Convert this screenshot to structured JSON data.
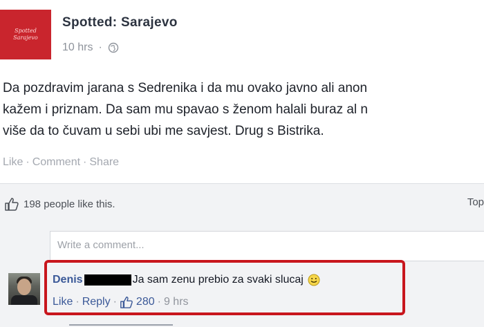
{
  "post": {
    "page_name": "Spotted: Sarajevo",
    "avatar_text_line1": "Spotted",
    "avatar_text_line2": "Sarajevo",
    "time": "10 hrs",
    "text_lines": [
      "Da pozdravim jarana s Sedrenika i da mu ovako javno ali anon",
      "kažem i priznam. Da sam mu spavao s ženom halali buraz al n",
      "više da to čuvam u sebi ubi me savjest. Drug s Bistrika."
    ],
    "actions": {
      "like": "Like",
      "comment": "Comment",
      "share": "Share",
      "separator": "·"
    }
  },
  "likes": {
    "text": "198 people like this.",
    "top_label": "Top"
  },
  "comment_input": {
    "placeholder": "Write a comment..."
  },
  "comment": {
    "author": "Denis",
    "text": "Ja sam zenu prebio za svaki slucaj",
    "actions": {
      "like": "Like",
      "reply": "Reply",
      "separator": "·",
      "like_count": "280",
      "time": "9 hrs"
    }
  },
  "icons": {
    "globe": "globe-icon",
    "thumb": "thumbs-up-icon",
    "smile": "smiley-icon"
  },
  "colors": {
    "link_blue": "#3b5998",
    "highlight_red": "#c8161d",
    "page_red": "#c9252d"
  }
}
